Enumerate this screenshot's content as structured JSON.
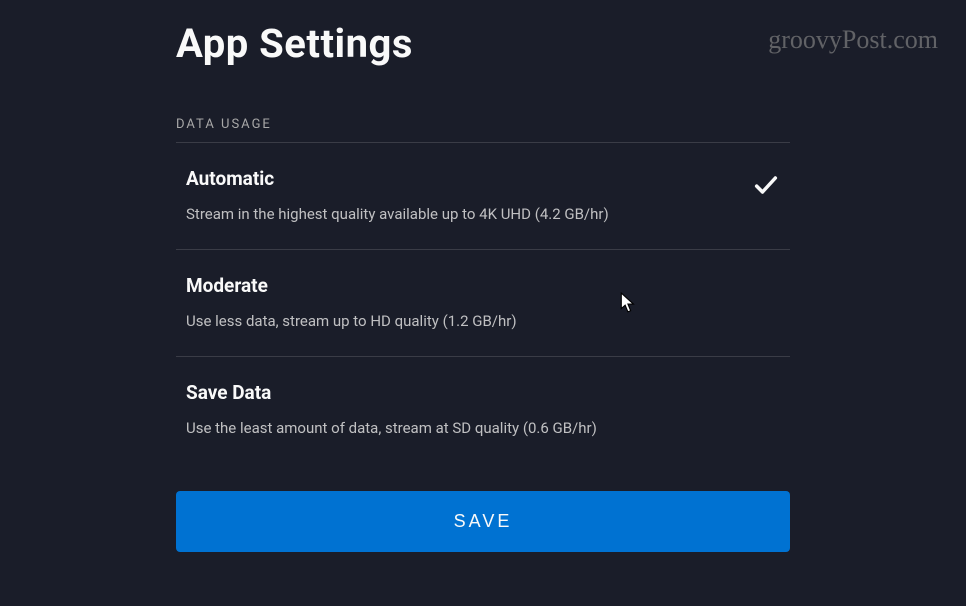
{
  "header": {
    "title": "App Settings",
    "watermark": "groovyPost.com"
  },
  "section": {
    "label": "DATA USAGE"
  },
  "options": [
    {
      "title": "Automatic",
      "description": "Stream in the highest quality available up to 4K UHD (4.2 GB/hr)",
      "selected": true
    },
    {
      "title": "Moderate",
      "description": "Use less data, stream up to HD quality (1.2 GB/hr)",
      "selected": false
    },
    {
      "title": "Save Data",
      "description": "Use the least amount of data, stream at SD quality (0.6 GB/hr)",
      "selected": false
    }
  ],
  "buttons": {
    "save": "SAVE"
  }
}
